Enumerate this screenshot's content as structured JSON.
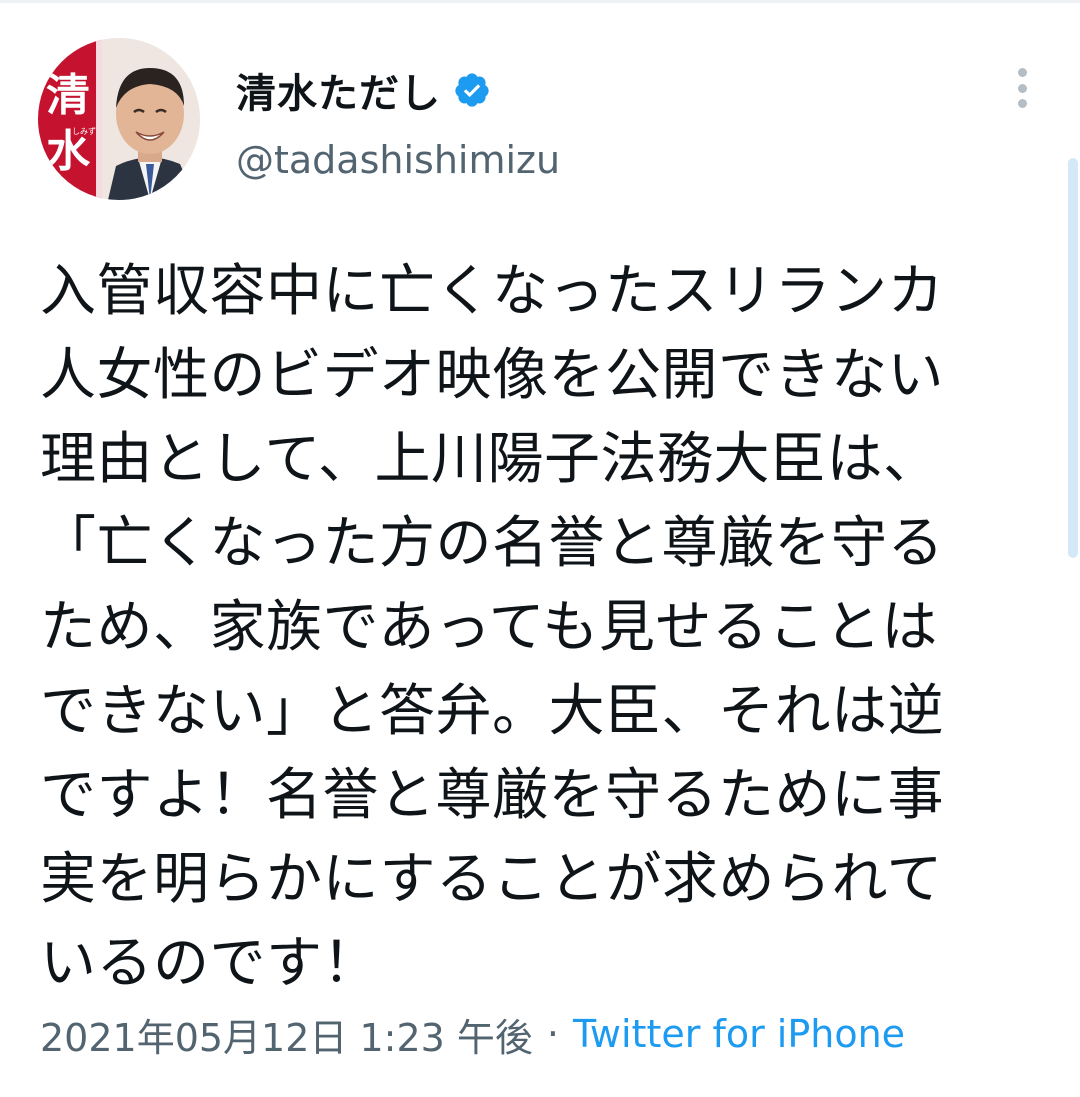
{
  "tweet": {
    "author": {
      "display_name": "清水ただし",
      "handle": "@tadashishimizu",
      "verified": true,
      "avatar_label": "清水",
      "avatar_sub_label": "しみず"
    },
    "body_lines": [
      "入管収容中に亡くなったスリランカ",
      "人女性のビデオ映像を公開できない",
      "理由として、上川陽子法務大臣は、",
      "「亡くなった方の名誉と尊厳を守る",
      "ため、家族であっても見せることは",
      "できない」と答弁。大臣、それは逆",
      "ですよ！名誉と尊厳を守るために事",
      "実を明らかにすることが求められて",
      "いるのです！"
    ],
    "meta": {
      "date": "2021年05月12日 1:23 午後",
      "separator": "·",
      "source": "Twitter for iPhone"
    }
  },
  "icons": {
    "verified": "verified-badge-icon",
    "more": "more-vertical-icon"
  },
  "colors": {
    "verified": "#1d9bf0",
    "link": "#1d9bf0",
    "secondary_text": "#536471",
    "avatar_banner": "#c4122f"
  }
}
